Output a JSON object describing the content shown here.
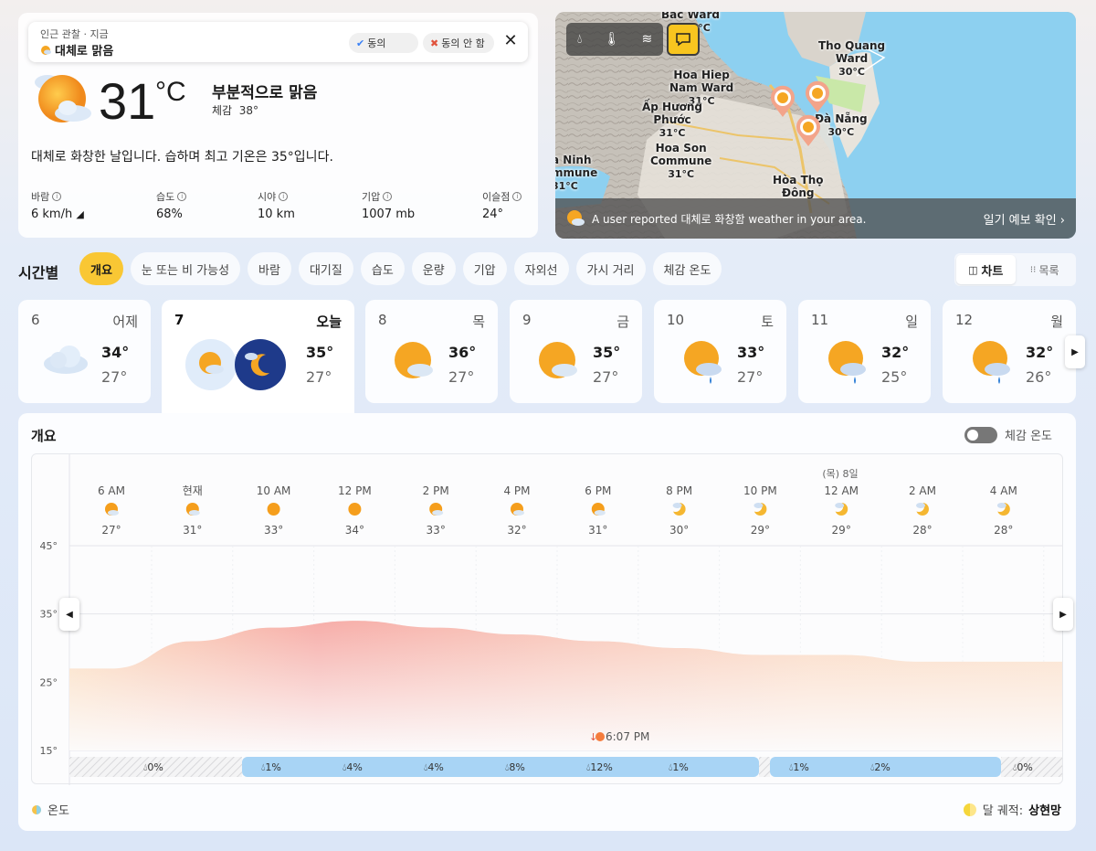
{
  "current": {
    "popup_sub": "인근 관찰 · 지금",
    "popup_condition": "대체로 맑음",
    "agree": "동의",
    "disagree": "동의 안 함",
    "temp": "31",
    "unit": "°C",
    "condition": "부분적으로 맑음",
    "feels_label": "체감",
    "feels_value": "38°",
    "summary": "대체로 화창한 날입니다. 습하며 최고 기온은 35°입니다.",
    "metrics": [
      {
        "label": "바람",
        "value": "6 km/h"
      },
      {
        "label": "습도",
        "value": "68%"
      },
      {
        "label": "시야",
        "value": "10 km"
      },
      {
        "label": "기압",
        "value": "1007 mb"
      },
      {
        "label": "이슬점",
        "value": "24°"
      }
    ]
  },
  "map": {
    "labels": [
      {
        "name": "Bac Ward",
        "temp": "°C"
      },
      {
        "name": "Tho Quang\nWard",
        "temp": "30°C"
      },
      {
        "name": "Hoa Hiep\nNam Ward",
        "temp": "31°C"
      },
      {
        "name": "Ấp Hương\nPhước",
        "temp": "31°C"
      },
      {
        "name": "Đà Nẵng",
        "temp": "30°C"
      },
      {
        "name": "Hoa Son\nCommune",
        "temp": "31°C"
      },
      {
        "name": "a Ninh\nmmune",
        "temp": "31°C"
      },
      {
        "name": "Hòa Thọ\nĐông",
        "temp": ""
      }
    ],
    "report_text": "A user reported 대체로 화창함 weather in your area.",
    "forecast_link": "일기 예보 확인"
  },
  "hourly": {
    "title": "시간별",
    "tabs": [
      "개요",
      "눈 또는 비 가능성",
      "바람",
      "대기질",
      "습도",
      "운량",
      "기압",
      "자외선",
      "가시 거리",
      "체감 온도"
    ],
    "view_chart": "차트",
    "view_list": "목록"
  },
  "days": [
    {
      "num": "6",
      "name": "어제",
      "hi": "34°",
      "lo": "27°",
      "icon": "cloudy"
    },
    {
      "num": "7",
      "name": "오늘",
      "hi": "35°",
      "lo": "27°",
      "icon": "day-night"
    },
    {
      "num": "8",
      "name": "목",
      "hi": "36°",
      "lo": "27°",
      "icon": "partly-sunny"
    },
    {
      "num": "9",
      "name": "금",
      "hi": "35°",
      "lo": "27°",
      "icon": "partly-sunny"
    },
    {
      "num": "10",
      "name": "토",
      "hi": "33°",
      "lo": "27°",
      "icon": "sun-rain"
    },
    {
      "num": "11",
      "name": "일",
      "hi": "32°",
      "lo": "25°",
      "icon": "sun-rain"
    },
    {
      "num": "12",
      "name": "월",
      "hi": "32°",
      "lo": "26°",
      "icon": "sun-rain"
    }
  ],
  "overview": {
    "title": "개요",
    "feels_toggle": "체감 온도",
    "legend": "온도",
    "moon_label": "달 궤적:",
    "moon_phase": "상현망",
    "sunset": "6:07 PM",
    "date_marker": "(목) 8일"
  },
  "chart_data": {
    "type": "area",
    "x": [
      "6 AM",
      "현재",
      "10 AM",
      "12 PM",
      "2 PM",
      "4 PM",
      "6 PM",
      "8 PM",
      "10 PM",
      "12 AM",
      "2 AM",
      "4 AM"
    ],
    "temps": [
      "27°",
      "31°",
      "33°",
      "34°",
      "33°",
      "32°",
      "31°",
      "30°",
      "29°",
      "29°",
      "28°",
      "28°"
    ],
    "y_values": [
      27,
      31,
      33,
      34,
      33,
      32,
      31,
      30,
      29,
      29,
      28,
      28
    ],
    "ylim": [
      15,
      45
    ],
    "y_ticks": [
      "45°",
      "35°",
      "25°",
      "15°"
    ],
    "precip": [
      {
        "text": "0%",
        "band": "none"
      },
      {
        "text": "1%",
        "band": "rain"
      },
      {
        "text": "4%",
        "band": "rain"
      },
      {
        "text": "4%",
        "band": "rain"
      },
      {
        "text": "8%",
        "band": "rain"
      },
      {
        "text": "12%",
        "band": "rain"
      },
      {
        "text": "1%",
        "band": "rain"
      },
      {
        "text": "1%",
        "band": "rain"
      },
      {
        "text": "2%",
        "band": "rain"
      },
      {
        "text": "0%",
        "band": "none"
      }
    ],
    "grid": true
  }
}
